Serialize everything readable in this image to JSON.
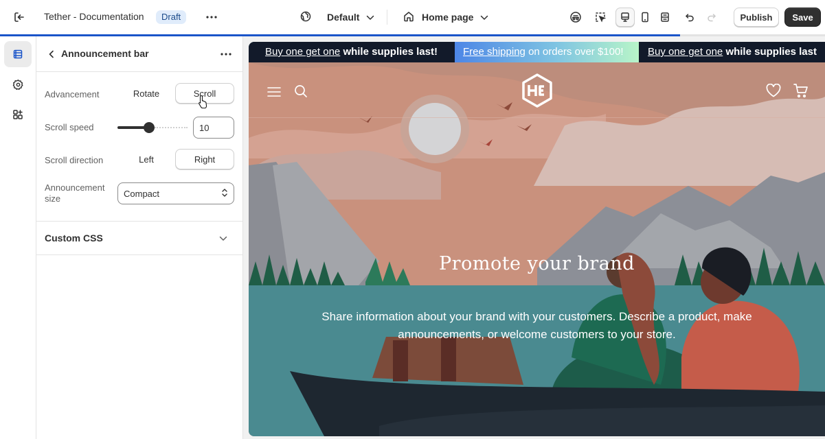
{
  "topbar": {
    "title": "Tether - Documentation",
    "status_badge": "Draft",
    "theme_label": "Default",
    "page_label": "Home page",
    "publish_label": "Publish",
    "save_label": "Save"
  },
  "panel": {
    "title": "Announcement bar",
    "advancement": {
      "label": "Advancement",
      "options": [
        "Rotate",
        "Scroll"
      ],
      "selected": "Scroll"
    },
    "scroll_speed": {
      "label": "Scroll speed",
      "value": "10",
      "fraction": 0.45
    },
    "scroll_direction": {
      "label": "Scroll direction",
      "options": [
        "Left",
        "Right"
      ],
      "selected": "Right"
    },
    "announcement_size": {
      "label_line1": "Announcement",
      "label_line2": "size",
      "value": "Compact"
    },
    "custom_css_label": "Custom CSS"
  },
  "preview": {
    "announcements": [
      {
        "link": "Buy one get one",
        "rest": "while supplies last!"
      },
      {
        "link": "Free shipping",
        "rest": "on orders over $100!"
      },
      {
        "link": "Buy one get one",
        "rest": "while supplies last"
      }
    ],
    "hero_title": "Promote your brand",
    "hero_body": "Share information about your brand with your customers. Describe a product, make announcements, or welcome customers to your store."
  },
  "colors": {
    "accent": "#1a54c9",
    "save_button": "#303030",
    "draft_badge": "#e0ecfb",
    "announcement_bg": "#121a2a"
  },
  "icons": [
    "exit-icon",
    "more-icon",
    "globe-icon",
    "chevron-down-icon",
    "home-icon",
    "accessibility-icon",
    "inspector-icon",
    "desktop-icon",
    "mobile-icon",
    "fullscreen-icon",
    "undo-icon",
    "redo-icon",
    "sections-icon",
    "gear-icon",
    "apps-icon",
    "back-icon",
    "select-chevrons-icon",
    "menu-icon",
    "search-icon",
    "logo-icon",
    "heart-icon",
    "cart-icon"
  ]
}
